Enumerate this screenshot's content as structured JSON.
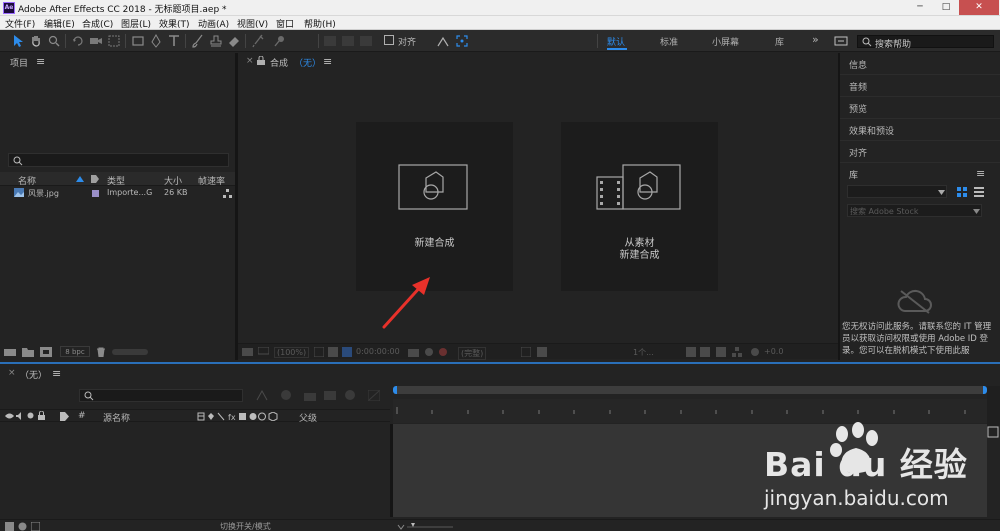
{
  "window": {
    "title": "Adobe After Effects CC 2018 - 无标题项目.aep *",
    "logo": "Ae",
    "minimize": "─",
    "maximize": "□",
    "close": "✕"
  },
  "menu": [
    "文件(F)",
    "编辑(E)",
    "合成(C)",
    "图层(L)",
    "效果(T)",
    "动画(A)",
    "视图(V)",
    "窗口",
    "帮助(H)"
  ],
  "toolbar": {
    "snap_label": "对齐",
    "workspaces": [
      "默认",
      "标准",
      "小屏幕",
      "库"
    ],
    "more": "»",
    "help_search_placeholder": "搜索帮助"
  },
  "project": {
    "title": "项目",
    "menu": "≡",
    "columns": [
      "名称",
      "类型",
      "大小",
      "帧速率"
    ],
    "items": [
      {
        "name": "风景.jpg",
        "type": "Importe...G",
        "size": "26 KB"
      }
    ],
    "bpc": "8 bpc"
  },
  "composition": {
    "close": "×",
    "tab_label": "合成",
    "tab_value": "（无）",
    "menu": "≡",
    "new_comp_label": "新建合成",
    "from_footage_line1": "从素材",
    "from_footage_line2": "新建合成",
    "footer": {
      "zoom": "(100%)",
      "timecode": "0:00:00:00",
      "resolution": "(完整)",
      "views": "1个...",
      "exposure": "+0.0"
    }
  },
  "right_panel": {
    "items": [
      "信息",
      "音频",
      "预览",
      "效果和预设",
      "对齐"
    ],
    "library_title": "库",
    "stock_search_placeholder": "搜索 Adobe Stock",
    "offline_message": "您无权访问此服务。请联系您的 IT 管理员以获取访问权限或使用 Adobe ID 登录。您可以在脱机模式下使用此服"
  },
  "timeline": {
    "close": "×",
    "tab_label": "（无）",
    "menu": "≡",
    "col_hash": "#",
    "col_source": "源名称",
    "col_parent": "父级",
    "switch_label": "切换开关/模式"
  },
  "colors": {
    "accent": "#2d8ceb",
    "arrow": "#e8312a",
    "panel_bg": "#232323"
  },
  "watermark": {
    "brand": "Bai du 经验",
    "url": "jingyan.baidu.com"
  }
}
